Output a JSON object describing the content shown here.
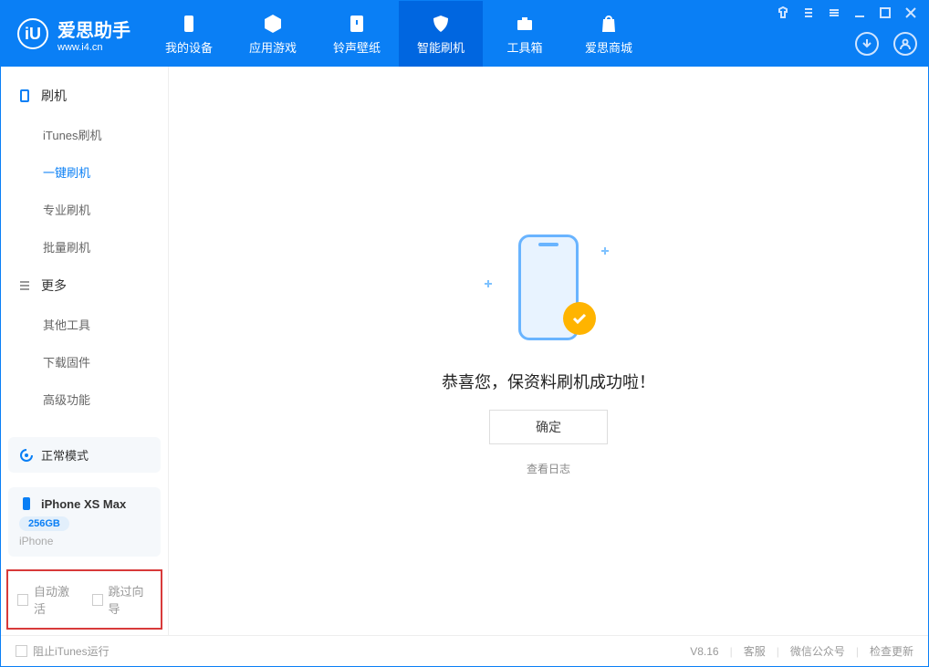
{
  "app": {
    "name": "爱思助手",
    "url": "www.i4.cn"
  },
  "nav": [
    {
      "label": "我的设备",
      "id": "my-device"
    },
    {
      "label": "应用游戏",
      "id": "apps-games"
    },
    {
      "label": "铃声壁纸",
      "id": "ringtones"
    },
    {
      "label": "智能刷机",
      "id": "smart-flash",
      "active": true
    },
    {
      "label": "工具箱",
      "id": "toolbox"
    },
    {
      "label": "爱思商城",
      "id": "store"
    }
  ],
  "sidebar": {
    "group1": {
      "title": "刷机",
      "items": [
        {
          "label": "iTunes刷机"
        },
        {
          "label": "一键刷机",
          "active": true
        },
        {
          "label": "专业刷机"
        },
        {
          "label": "批量刷机"
        }
      ]
    },
    "group2": {
      "title": "更多",
      "items": [
        {
          "label": "其他工具"
        },
        {
          "label": "下载固件"
        },
        {
          "label": "高级功能"
        }
      ]
    }
  },
  "device_status": {
    "mode": "正常模式"
  },
  "device": {
    "name": "iPhone XS Max",
    "storage": "256GB",
    "type": "iPhone"
  },
  "options": {
    "auto_activate": "自动激活",
    "skip_wizard": "跳过向导"
  },
  "success": {
    "message": "恭喜您，保资料刷机成功啦！",
    "confirm": "确定",
    "view_log": "查看日志"
  },
  "footer": {
    "block_itunes": "阻止iTunes运行",
    "version": "V8.16",
    "links": [
      "客服",
      "微信公众号",
      "检查更新"
    ]
  }
}
